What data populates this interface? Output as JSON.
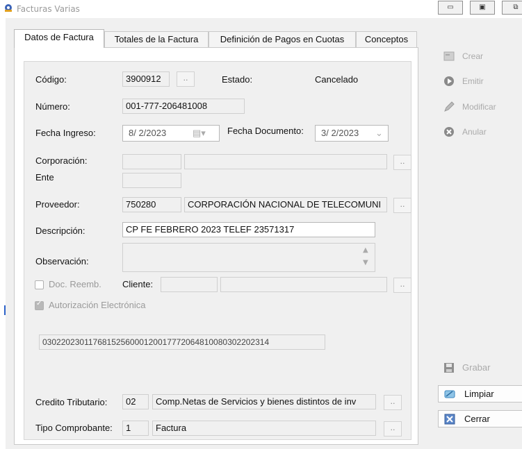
{
  "window": {
    "title": "Facturas Varias"
  },
  "tabs": [
    {
      "label": "Datos de Factura"
    },
    {
      "label": "Totales de la Factura"
    },
    {
      "label": "Definición de Pagos en Cuotas"
    },
    {
      "label": "Conceptos"
    }
  ],
  "form": {
    "codigo_label": "Código:",
    "codigo_value": "3900912",
    "estado_label": "Estado:",
    "estado_value": "Cancelado",
    "numero_label": "Número:",
    "numero_value": "001-777-206481008",
    "fecha_ingreso_label": "Fecha Ingreso:",
    "fecha_ingreso_value": "8/ 2/2023",
    "fecha_documento_label": "Fecha Documento:",
    "fecha_documento_value": "3/ 2/2023",
    "corporacion_label": "Corporación:",
    "ente_label": "Ente",
    "proveedor_label": "Proveedor:",
    "proveedor_code": "750280",
    "proveedor_name": "CORPORACIÓN NACIONAL DE TELECOMUNI",
    "descripcion_label": "Descripción:",
    "descripcion_value": "CP FE FEBRERO 2023 TELEF 23571317",
    "observacion_label": "Observación:",
    "doc_reemb_label": "Doc. Reemb.",
    "cliente_label": "Cliente:",
    "autorizacion_label": "Autorización Electrónica",
    "autorizacion_value": "0302202301176815256000120017772064810080302202314",
    "credito_label": "Credito Tributario:",
    "credito_code": "02",
    "credito_desc": "Comp.Netas de Servicios y bienes distintos de inv",
    "tipo_label": "Tipo Comprobante:",
    "tipo_code": "1",
    "tipo_desc": "Factura",
    "dots": ".."
  },
  "actions": {
    "crear": "Crear",
    "emitir": "Emitir",
    "modificar": "Modificar",
    "anular": "Anular",
    "grabar": "Grabar",
    "limpiar": "Limpiar",
    "cerrar": "Cerrar"
  },
  "colors": {
    "accent": "#2c62c9",
    "disabled_text": "#9a9a9a",
    "panel_bg": "#f0f0f0"
  },
  "icons": {
    "app": "app-logo-icon",
    "minimize": "minimize-icon",
    "maximize": "maximize-icon",
    "restore": "restore-icon"
  }
}
